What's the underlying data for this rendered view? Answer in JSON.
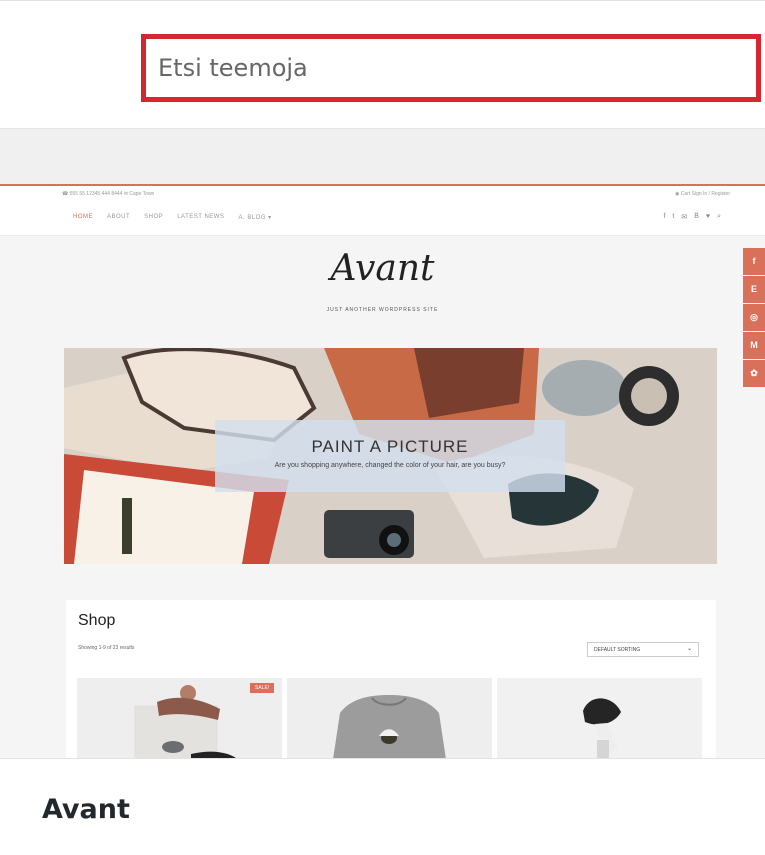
{
  "search": {
    "placeholder": "Etsi teemoja",
    "accent_color": "#d4272f"
  },
  "preview": {
    "utility_contact": "☎ 555 55 12345 444 8444  ✉ Cape Town",
    "utility_account": "◉ Cart    Sign In / Register",
    "nav": [
      "HOME",
      "ABOUT",
      "SHOP",
      "LATEST NEWS",
      "A. BLOG ▾"
    ],
    "nav_active": "HOME",
    "nav_icons": [
      "f",
      "t",
      "✉",
      "B̈",
      "♥",
      "⌕"
    ],
    "logo": "Avant",
    "tagline": "JUST ANOTHER WORDPRESS SITE",
    "hero": {
      "title": "PAINT A PICTURE",
      "subtitle": "Are you shopping anywhere, changed the color of your hair, are you busy?"
    },
    "social_rail": [
      "f",
      "E",
      "◎",
      "M",
      "✿"
    ],
    "shop": {
      "title": "Shop",
      "results": "Showing 1-9 of 23 results",
      "sort": "DEFAULT SORTING",
      "sale_badge": "SALE!"
    },
    "accent_color": "#d9705a"
  },
  "theme": {
    "name": "Avant"
  }
}
